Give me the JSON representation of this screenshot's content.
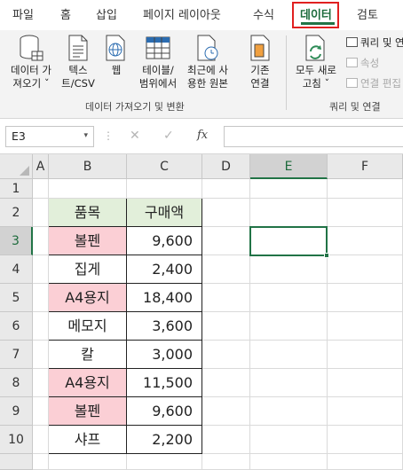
{
  "tabs": [
    "파일",
    "홈",
    "삽입",
    "페이지 레이아웃",
    "수식",
    "데이터",
    "검토"
  ],
  "ribbon": {
    "btn_get_data": [
      "데이터 가",
      "져오기 ˇ"
    ],
    "btn_text_csv": [
      "텍스",
      "트/CSV"
    ],
    "btn_web": [
      "웹"
    ],
    "btn_table_range": [
      "테이블/",
      "범위에서"
    ],
    "btn_recent": [
      "최근에 사",
      "용한 원본"
    ],
    "btn_existing": [
      "기존",
      "연결"
    ],
    "btn_refresh_all": [
      "모두 새로",
      "고침 ˇ"
    ],
    "small_queries": "쿼리 및 연",
    "small_properties": "속성",
    "small_edit_links": "연결 편집",
    "group_get_transform": "데이터 가져오기 및 변환",
    "group_queries": "쿼리 및 연결"
  },
  "formula_bar": {
    "name_box": "E3",
    "dropdown_glyph": "▾",
    "dots_glyph": "⋮",
    "cancel_glyph": "✕",
    "enter_glyph": "✓",
    "fx_label": "fx",
    "formula": ""
  },
  "sheet": {
    "columns": [
      "A",
      "B",
      "C",
      "D",
      "E",
      "F"
    ],
    "rows": [
      "1",
      "2",
      "3",
      "4",
      "5",
      "6",
      "7",
      "8",
      "9",
      "10"
    ],
    "selected_cell": "E3",
    "header": {
      "item": "품목",
      "amount": "구매액"
    },
    "data": [
      {
        "item": "볼펜",
        "amount": "9,600",
        "pink": true
      },
      {
        "item": "집게",
        "amount": "2,400",
        "pink": false
      },
      {
        "item": "A4용지",
        "amount": "18,400",
        "pink": true
      },
      {
        "item": "메모지",
        "amount": "3,600",
        "pink": false
      },
      {
        "item": "칼",
        "amount": "3,000",
        "pink": false
      },
      {
        "item": "A4용지",
        "amount": "11,500",
        "pink": true
      },
      {
        "item": "볼펜",
        "amount": "9,600",
        "pink": true
      },
      {
        "item": "샤프",
        "amount": "2,200",
        "pink": false
      }
    ]
  },
  "colors": {
    "accent": "#217346",
    "highlight_box": "#e02020",
    "header_fill": "#e2efda",
    "pink_fill": "#fbcfd5"
  }
}
